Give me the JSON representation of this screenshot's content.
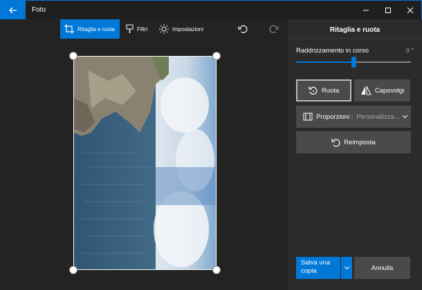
{
  "titlebar": {
    "app_title": "Foto"
  },
  "toolbar": {
    "crop_label": "Ritaglia e ruota",
    "filters_label": "Filtri",
    "settings_label": "Impostazioni"
  },
  "panel": {
    "title": "Ritaglia e ruota",
    "straighten_label": "Raddrizzamento in corso",
    "straighten_value": "0 °",
    "straighten_level": 0.5,
    "rotate_label": "Ruota",
    "flip_label": "Capovolgi",
    "ratio_label": "Proporzioni :",
    "ratio_value": "Personalizza...",
    "reset_label": "Reimposta",
    "save_label_line1": "Salva una",
    "save_label_line2": "copia",
    "cancel_label": "Annulla"
  },
  "colors": {
    "accent": "#0078d7",
    "panel": "#2b2b2b",
    "button": "#4a4a4a"
  }
}
